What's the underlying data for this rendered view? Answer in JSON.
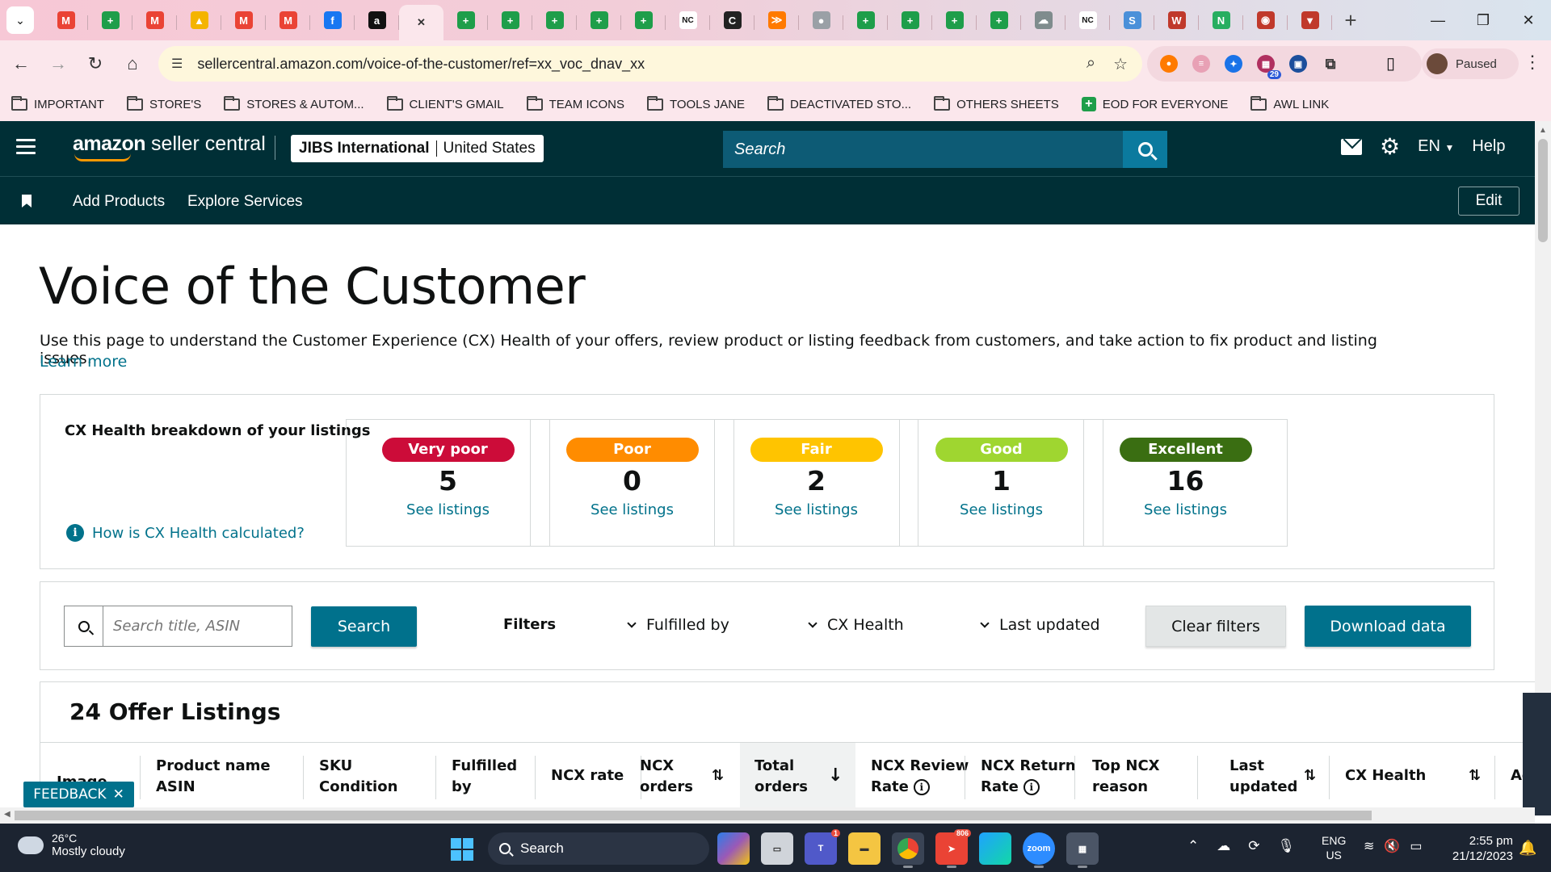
{
  "browser": {
    "tabs": [
      {
        "icon": "gmail-icon",
        "glyph": "M",
        "color": "#ea4335"
      },
      {
        "icon": "sheets-icon",
        "glyph": "+",
        "color": "#1e9e4a"
      },
      {
        "icon": "gmail-icon",
        "glyph": "M",
        "color": "#ea4335"
      },
      {
        "icon": "drive-icon",
        "glyph": "▲",
        "color": "#f4b400"
      },
      {
        "icon": "gmail-icon",
        "glyph": "M",
        "color": "#ea4335"
      },
      {
        "icon": "gmail-icon",
        "glyph": "M",
        "color": "#ea4335"
      },
      {
        "icon": "facebook-icon",
        "glyph": "f",
        "color": "#1877f2"
      },
      {
        "icon": "amazon-icon",
        "glyph": "a",
        "color": "#111111"
      },
      {
        "icon": "close-icon",
        "glyph": "✕",
        "color": "transparent",
        "active": true
      },
      {
        "icon": "sheets-icon",
        "glyph": "+",
        "color": "#1e9e4a"
      },
      {
        "icon": "sheets-icon",
        "glyph": "+",
        "color": "#1e9e4a"
      },
      {
        "icon": "sheets-icon",
        "glyph": "+",
        "color": "#1e9e4a"
      },
      {
        "icon": "sheets-icon",
        "glyph": "+",
        "color": "#1e9e4a"
      },
      {
        "icon": "sheets-icon",
        "glyph": "+",
        "color": "#1e9e4a"
      },
      {
        "icon": "nc-icon",
        "glyph": "NC",
        "color": "#ffffff"
      },
      {
        "icon": "c-icon",
        "glyph": "C",
        "color": "#222222"
      },
      {
        "icon": "clickup-icon",
        "glyph": "≫",
        "color": "#ff7a00"
      },
      {
        "icon": "globe-icon",
        "glyph": "●",
        "color": "#9aa0a6"
      },
      {
        "icon": "sheets-icon",
        "glyph": "+",
        "color": "#1e9e4a"
      },
      {
        "icon": "sheets-icon",
        "glyph": "+",
        "color": "#1e9e4a"
      },
      {
        "icon": "sheets-icon",
        "glyph": "+",
        "color": "#1e9e4a"
      },
      {
        "icon": "sheets-icon",
        "glyph": "+",
        "color": "#1e9e4a"
      },
      {
        "icon": "cloud-icon",
        "glyph": "☁",
        "color": "#7f8c8d"
      },
      {
        "icon": "nc-icon",
        "glyph": "NC",
        "color": "#ffffff"
      },
      {
        "icon": "sysco-icon",
        "glyph": "S",
        "color": "#4a90d9"
      },
      {
        "icon": "ww-icon",
        "glyph": "W",
        "color": "#c0392b"
      },
      {
        "icon": "n-icon",
        "glyph": "N",
        "color": "#27ae60"
      },
      {
        "icon": "badge-icon",
        "glyph": "◉",
        "color": "#c0392b"
      },
      {
        "icon": "triangle-icon",
        "glyph": "▼",
        "color": "#c0392b"
      }
    ],
    "url": "sellercentral.amazon.com/voice-of-the-customer/ref=xx_voc_dnav_xx",
    "profile_status": "Paused",
    "extension_badge": "29",
    "bookmarks": [
      {
        "label": "IMPORTANT",
        "type": "folder"
      },
      {
        "label": "STORE'S",
        "type": "folder"
      },
      {
        "label": "STORES & AUTOM...",
        "type": "folder"
      },
      {
        "label": "CLIENT'S GMAIL",
        "type": "folder"
      },
      {
        "label": "TEAM ICONS",
        "type": "folder"
      },
      {
        "label": "TOOLS JANE",
        "type": "folder"
      },
      {
        "label": "DEACTIVATED STO...",
        "type": "folder"
      },
      {
        "label": "OTHERS SHEETS",
        "type": "folder"
      },
      {
        "label": "EOD FOR EVERYONE",
        "type": "sheet"
      },
      {
        "label": "AWL LINK",
        "type": "folder"
      }
    ]
  },
  "header": {
    "logo_bold": "amazon",
    "logo_rest": " seller central",
    "store_name": "JIBS International",
    "store_region": "United States",
    "search_placeholder": "Search",
    "language": "EN",
    "help": "Help"
  },
  "nav": {
    "links": [
      "Add Products",
      "Explore Services"
    ],
    "edit": "Edit"
  },
  "main": {
    "title": "Voice of the Customer",
    "description": "Use this page to understand the Customer Experience (CX) Health of your offers, review product or listing feedback from customers, and take action to fix product and listing issues.",
    "learn_more": "Learn more"
  },
  "cx_health": {
    "title": "CX Health breakdown of your listings",
    "how_link": "How is CX Health calculated?",
    "see_label": "See listings",
    "boxes": [
      {
        "label": "Very poor",
        "count": "5",
        "color": "#cc0c39",
        "text_color": "#ffffff"
      },
      {
        "label": "Poor",
        "count": "0",
        "color": "#ff8c00",
        "text_color": "#ffffff"
      },
      {
        "label": "Fair",
        "count": "2",
        "color": "#ffc400",
        "text_color": "#ffffff"
      },
      {
        "label": "Good",
        "count": "1",
        "color": "#9fd630",
        "text_color": "#ffffff"
      },
      {
        "label": "Excellent",
        "count": "16",
        "color": "#3a6e12",
        "text_color": "#ffffff"
      }
    ]
  },
  "filters": {
    "search_placeholder": "Search title, ASIN",
    "search_button": "Search",
    "filters_label": "Filters",
    "dropdowns": [
      "Fulfilled by",
      "CX Health",
      "Last updated"
    ],
    "clear_button": "Clear filters",
    "download_button": "Download data"
  },
  "listings": {
    "title": "24 Offer Listings",
    "columns": {
      "image": "Image",
      "product_line1": "Product name",
      "product_line2": "ASIN",
      "sku_line1": "SKU",
      "sku_line2": "Condition",
      "fulfilled_line1": "Fulfilled",
      "fulfilled_line2": "by",
      "ncx_rate": "NCX rate",
      "ncx_orders_line1": "NCX",
      "ncx_orders_line2": "orders",
      "total_orders_line1": "Total",
      "total_orders_line2": "orders",
      "review_line1": "NCX Review",
      "review_line2": "Rate",
      "return_line1": "NCX Return",
      "return_line2": "Rate",
      "top_line1": "Top NCX",
      "top_line2": "reason",
      "updated_line1": "Last",
      "updated_line2": "updated",
      "cx_health": "CX Health",
      "actions_partial": "Ac"
    }
  },
  "feedback": {
    "label": "FEEDBACK"
  },
  "taskbar": {
    "temperature": "26°C",
    "weather": "Mostly cloudy",
    "search": "Search",
    "lang_line1": "ENG",
    "lang_line2": "US",
    "time": "2:55 pm",
    "date": "21/12/2023",
    "telegram_badge": "806",
    "teams_badge": "1"
  }
}
